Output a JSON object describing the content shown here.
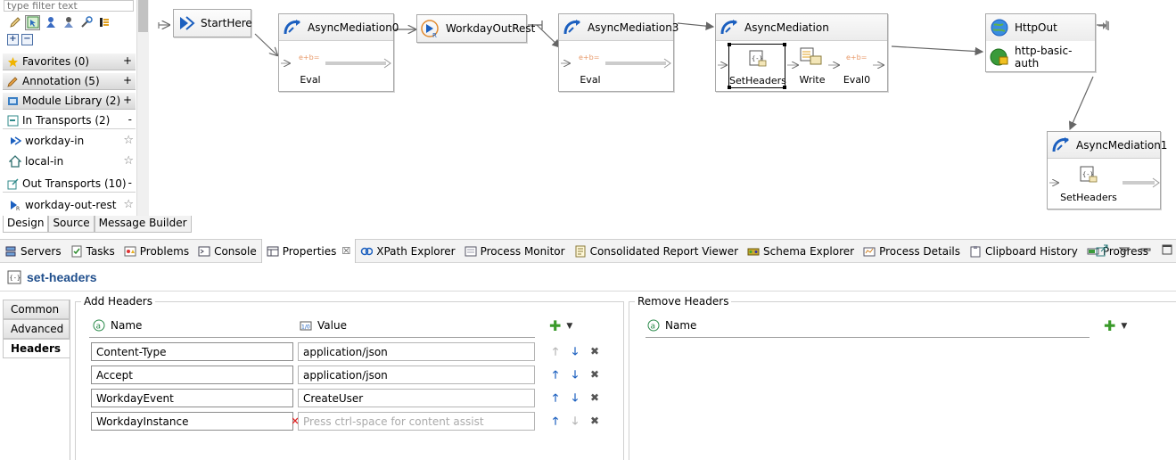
{
  "palette": {
    "filter_placeholder": "type filter text",
    "drawers": [
      {
        "label": "Favorites (0)",
        "toggle": "+"
      },
      {
        "label": "Annotation (5)",
        "toggle": "+"
      },
      {
        "label": "Module Library (2)",
        "toggle": "+"
      },
      {
        "label": "In Transports (2)",
        "toggle": "-"
      },
      {
        "label": "Out Transports (10)",
        "toggle": "-"
      }
    ],
    "in_entries": [
      "workday-in",
      "local-in"
    ],
    "out_entries": [
      "workday-out-rest"
    ],
    "star": "☆"
  },
  "editor_tabs": [
    "Design",
    "Source",
    "Message Builder"
  ],
  "canvas": {
    "start": "StartHere",
    "async0": {
      "title": "AsyncMediation0",
      "steps": [
        "Eval"
      ],
      "step_glyph": "e+b="
    },
    "out_rest": "WorkdayOutRest",
    "async3": {
      "title": "AsyncMediation3",
      "steps": [
        "Eval"
      ],
      "step_glyph": "e+b="
    },
    "async": {
      "title": "AsyncMediation",
      "steps": [
        "SetHeaders",
        "Write",
        "Eval0"
      ],
      "step_glyph": "e+b="
    },
    "http": {
      "title": "HttpOut",
      "auth": "http-basic-auth"
    },
    "async1": {
      "title": "AsyncMediation1",
      "steps": [
        "SetHeaders"
      ]
    }
  },
  "views": {
    "tabs": [
      "Servers",
      "Tasks",
      "Problems",
      "Console",
      "Properties",
      "XPath Explorer",
      "Process Monitor",
      "Consolidated Report Viewer",
      "Schema Explorer",
      "Process Details",
      "Clipboard History",
      "Progress"
    ],
    "active": "Properties",
    "close_glyph": "☒"
  },
  "properties": {
    "title": "set-headers",
    "side_tabs": [
      "Common",
      "Advanced",
      "Headers"
    ],
    "active_side_tab": "Headers",
    "add_headers": {
      "legend": "Add Headers",
      "name_col": "Name",
      "value_col": "Value",
      "rows": [
        {
          "name": "Content-Type",
          "value": "application/json"
        },
        {
          "name": "Accept",
          "value": "application/json"
        },
        {
          "name": "WorkdayEvent",
          "value": "CreateUser"
        },
        {
          "name": "WorkdayInstance",
          "value": "",
          "placeholder": "Press ctrl-space for content assist"
        }
      ]
    },
    "remove_headers": {
      "legend": "Remove Headers",
      "name_col": "Name"
    }
  },
  "colors": {
    "accent": "#1f4e8c",
    "add_green": "#3a9a2a",
    "arrow_blue": "#1b5fbf"
  }
}
